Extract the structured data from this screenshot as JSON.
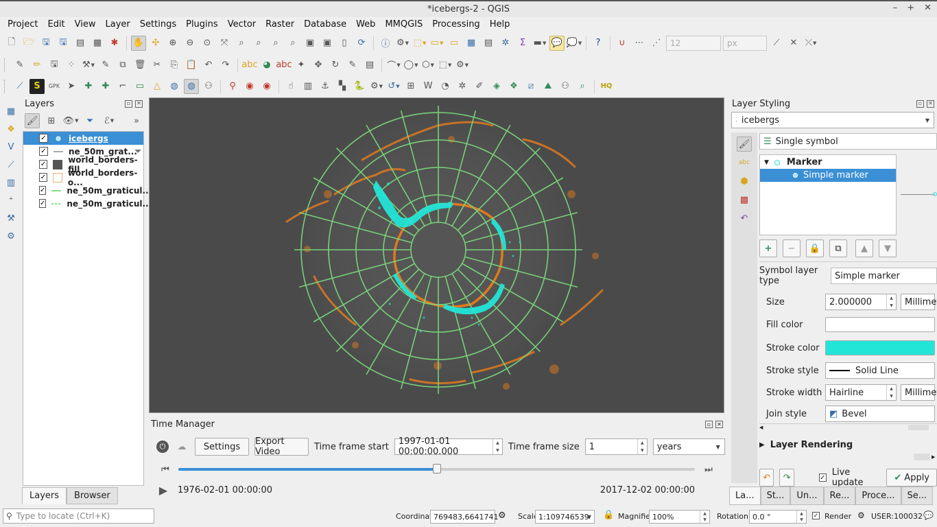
{
  "window": {
    "title": "*icebergs-2 - QGIS"
  },
  "menu": [
    "Project",
    "Edit",
    "View",
    "Layer",
    "Settings",
    "Plugins",
    "Vector",
    "Raster",
    "Database",
    "Web",
    "MMQGIS",
    "Processing",
    "Help"
  ],
  "toolbar": {
    "font_size_value": "12",
    "font_unit": "px"
  },
  "layers_panel": {
    "title": "Layers",
    "items": [
      {
        "name": "icebergs",
        "checked": true,
        "symbol": "point-icon",
        "selected": true
      },
      {
        "name": "ne_50m_grat...",
        "checked": true,
        "symbol": "line-icon",
        "filtered": true
      },
      {
        "name": "world_borders-fill",
        "checked": true,
        "symbol": "fill-icon"
      },
      {
        "name": "world_borders-o...",
        "checked": true,
        "symbol": "outline-icon"
      },
      {
        "name": "ne_50m_graticul...",
        "checked": true,
        "symbol": "green-line-icon"
      },
      {
        "name": "ne_50m_graticul...",
        "checked": true,
        "symbol": "dashed-line-icon"
      }
    ],
    "tabs": [
      "Layers",
      "Browser"
    ]
  },
  "time_manager": {
    "title": "Time Manager",
    "settings_label": "Settings",
    "export_label": "Export Video",
    "frame_start_label": "Time frame start",
    "frame_start_value": "1997-01-01 00:00:00.000",
    "frame_size_label": "Time frame size",
    "frame_size_value": "1",
    "frame_unit": "years",
    "range_start": "1976-02-01 00:00:00",
    "range_end": "2017-12-02 00:00:00",
    "slider_position": 0.5
  },
  "layer_styling": {
    "title": "Layer Styling",
    "layer": "icebergs",
    "renderer": "Single symbol",
    "tree": {
      "root": "Marker",
      "child": "Simple marker"
    },
    "symbol_layer_type_label": "Symbol layer type",
    "symbol_layer_type": "Simple marker",
    "props": {
      "size_label": "Size",
      "size_value": "2.000000",
      "size_unit": "Millimet",
      "fill_label": "Fill color",
      "fill_color": "#ffffff",
      "stroke_label": "Stroke color",
      "stroke_color": "#22e5d8",
      "stroke_style_label": "Stroke style",
      "stroke_style_value": "Solid Line",
      "stroke_width_label": "Stroke width",
      "stroke_width_value": "Hairline",
      "stroke_width_unit": "Millimet",
      "join_label": "Join style",
      "join_value": "Bevel"
    },
    "layer_rendering": "Layer Rendering",
    "live_update": "Live update",
    "apply": "Apply",
    "bottom_tabs": [
      "La...",
      "St...",
      "Un...",
      "Re...",
      "Proce...",
      "Se..."
    ]
  },
  "statusbar": {
    "locate_placeholder": "Type to locate (Ctrl+K)",
    "coordinate_label": "Coordinate",
    "coordinate_value": "769483,6641741",
    "scale_label": "Scale",
    "scale_value": "1:109746539",
    "magnifier_label": "Magnifier",
    "magnifier_value": "100%",
    "rotation_label": "Rotation",
    "rotation_value": "0.0 °",
    "render_label": "Render",
    "crs": "USER:100032"
  },
  "colors": {
    "accent": "#3a8fd5",
    "graticule": "#7dde7d",
    "iceberg": "#22e5d8",
    "coast": "#e07a1e",
    "map_bg": "#4a4a4a"
  }
}
